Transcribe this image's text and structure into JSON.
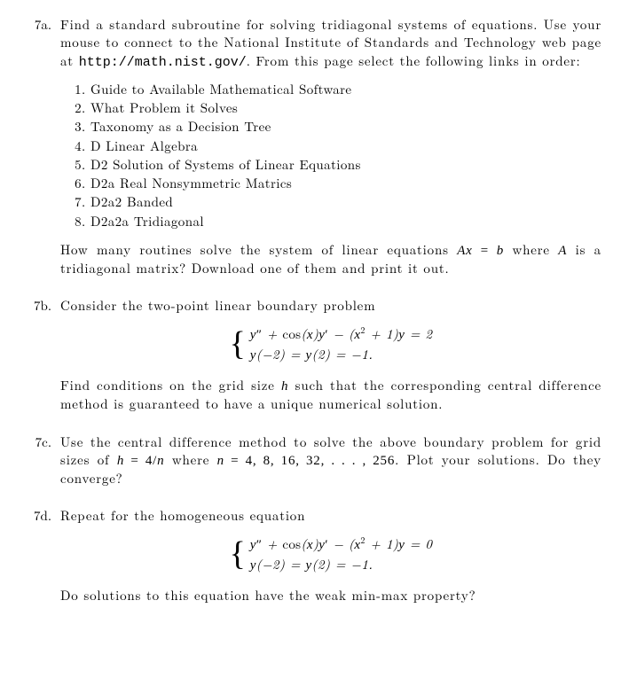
{
  "p7a": {
    "label": "7a.",
    "para1_a": "Find a standard subroutine for solving tridiagonal systems of equations. Use your mouse to connect to the National Institute of Standards and Technology web page at ",
    "url": "http://math.nist.gov/",
    "para1_b": ". From this page select the following links in order:",
    "links": [
      "Guide to Available Mathematical Software",
      "What Problem it Solves",
      "Taxonomy as a Decision Tree",
      "D Linear Algebra",
      "D2 Solution of Systems of Linear Equations",
      "D2a Real Nonsymmetric Matrics",
      "D2a2 Banded",
      "D2a2a Tridiagonal"
    ],
    "para2_a": "How many routines solve the system of linear equations ",
    "para2_math": "Ax = b",
    "para2_b": " where ",
    "para2_math2": "A",
    "para2_c": " is a tridiagonal matrix? Download one of them and print it out."
  },
  "p7b": {
    "label": "7b.",
    "para1": "Consider the two-point linear boundary problem",
    "sys_line1": "y″ + cos(x)y′ − (x² + 1)y = 2",
    "sys_line2": "y(−2) = y(2) = −1.",
    "para2_a": "Find conditions on the grid size ",
    "para2_math": "h",
    "para2_b": " such that the corresponding central difference method is guaranteed to have a unique numerical solution."
  },
  "p7c": {
    "label": "7c.",
    "para1_a": "Use the central difference method to solve the above boundary problem for grid sizes of ",
    "para1_math1": "h = 4/n",
    "para1_b": " where ",
    "para1_math2": "n = 4, 8, 16, 32, . . . , 256",
    "para1_c": ". Plot your solutions. Do they converge?"
  },
  "p7d": {
    "label": "7d.",
    "para1": "Repeat for the homogeneous equation",
    "sys_line1": "y″ + cos(x)y′ − (x² + 1)y = 0",
    "sys_line2": "y(−2) = y(2) = −1.",
    "para2": "Do solutions to this equation have the weak min-max property?"
  }
}
